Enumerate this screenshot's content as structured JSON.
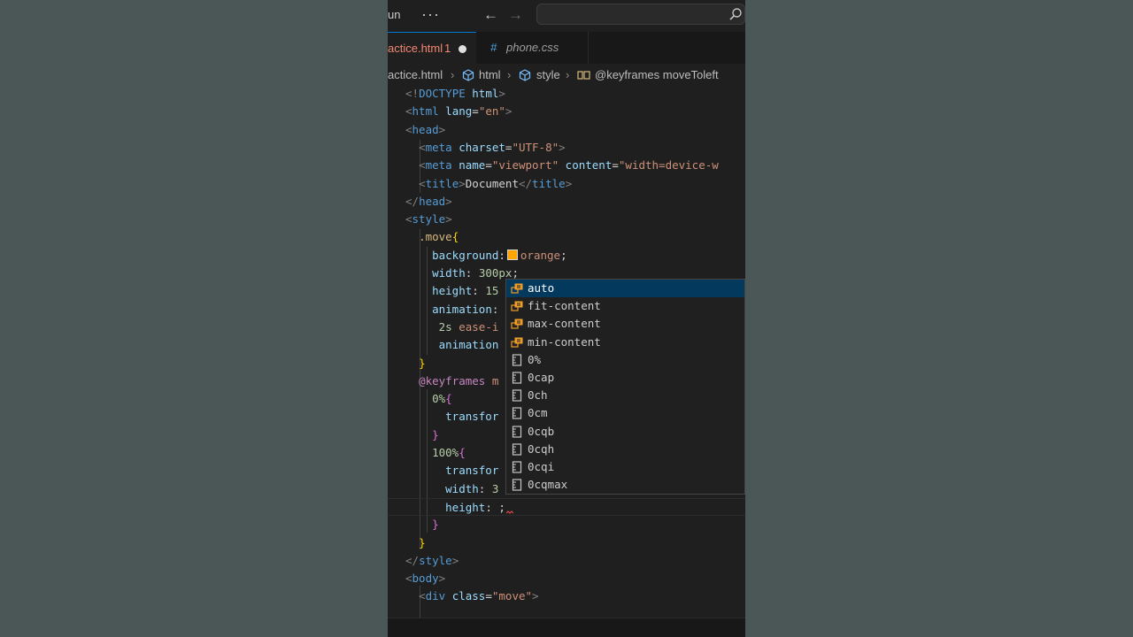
{
  "titlebar": {
    "title_fragment": "un",
    "more_label": "···",
    "back_icon": "arrow-left-icon",
    "forward_icon": "arrow-right-icon",
    "search_icon": "search-icon"
  },
  "tabs": [
    {
      "label": "actice.html",
      "problems": "1",
      "modified": true,
      "color": "#f48771"
    },
    {
      "hash": "#",
      "label": "phone.css",
      "color": "#9d9d9d"
    }
  ],
  "breadcrumb": {
    "file": "actice.html",
    "items": [
      {
        "label": "html",
        "icon": "cube-icon"
      },
      {
        "label": "style",
        "icon": "cube-icon"
      },
      {
        "label": "@keyframes moveToleft",
        "icon": "symbol-key-icon"
      }
    ]
  },
  "code_lines": [
    [
      [
        "t-tag",
        "<!"
      ],
      [
        "t-name",
        "DOCTYPE"
      ],
      [
        "t-text",
        " "
      ],
      [
        "t-attr",
        "html"
      ],
      [
        "t-tag",
        ">"
      ]
    ],
    [
      [
        "t-tag",
        "<"
      ],
      [
        "t-name",
        "html"
      ],
      [
        "t-text",
        " "
      ],
      [
        "t-attr",
        "lang"
      ],
      [
        "t-text",
        "="
      ],
      [
        "t-str",
        "\"en\""
      ],
      [
        "t-tag",
        ">"
      ]
    ],
    [
      [
        "t-tag",
        "<"
      ],
      [
        "t-name",
        "head"
      ],
      [
        "t-tag",
        ">"
      ]
    ],
    [
      [
        "t-text",
        "  "
      ],
      [
        "t-tag",
        "<"
      ],
      [
        "t-name",
        "meta"
      ],
      [
        "t-text",
        " "
      ],
      [
        "t-attr",
        "charset"
      ],
      [
        "t-text",
        "="
      ],
      [
        "t-str",
        "\"UTF-8\""
      ],
      [
        "t-tag",
        ">"
      ]
    ],
    [
      [
        "t-text",
        "  "
      ],
      [
        "t-tag",
        "<"
      ],
      [
        "t-name",
        "meta"
      ],
      [
        "t-text",
        " "
      ],
      [
        "t-attr",
        "name"
      ],
      [
        "t-text",
        "="
      ],
      [
        "t-str",
        "\"viewport\""
      ],
      [
        "t-text",
        " "
      ],
      [
        "t-attr",
        "content"
      ],
      [
        "t-text",
        "="
      ],
      [
        "t-str",
        "\"width=device-w"
      ]
    ],
    [
      [
        "t-text",
        "  "
      ],
      [
        "t-tag",
        "<"
      ],
      [
        "t-name",
        "title"
      ],
      [
        "t-tag",
        ">"
      ],
      [
        "t-text",
        "Document"
      ],
      [
        "t-tag",
        "</"
      ],
      [
        "t-name",
        "title"
      ],
      [
        "t-tag",
        ">"
      ]
    ],
    [
      [
        "t-tag",
        "</"
      ],
      [
        "t-name",
        "head"
      ],
      [
        "t-tag",
        ">"
      ]
    ],
    [
      [
        "t-tag",
        "<"
      ],
      [
        "t-name",
        "style"
      ],
      [
        "t-tag",
        ">"
      ]
    ],
    [
      [
        "t-text",
        "  "
      ],
      [
        "t-sel",
        ".move"
      ],
      [
        "t-br1",
        "{"
      ]
    ],
    [
      [
        "t-text",
        "    "
      ],
      [
        "t-prop",
        "background"
      ],
      [
        "t-text",
        ":"
      ],
      [
        "swatch",
        ""
      ],
      [
        "t-val",
        "orange"
      ],
      [
        "t-text",
        ";"
      ]
    ],
    [
      [
        "t-text",
        "    "
      ],
      [
        "t-prop",
        "width"
      ],
      [
        "t-text",
        ": "
      ],
      [
        "t-num",
        "300px"
      ],
      [
        "t-text",
        ";"
      ]
    ],
    [
      [
        "t-text",
        "    "
      ],
      [
        "t-prop",
        "height"
      ],
      [
        "t-text",
        ": "
      ],
      [
        "t-num",
        "15"
      ]
    ],
    [
      [
        "t-text",
        "    "
      ],
      [
        "t-prop",
        "animation"
      ],
      [
        "t-text",
        ":"
      ]
    ],
    [
      [
        "t-text",
        "     "
      ],
      [
        "t-num",
        "2s"
      ],
      [
        "t-text",
        " "
      ],
      [
        "t-val",
        "ease-i"
      ]
    ],
    [
      [
        "t-text",
        "     "
      ],
      [
        "t-prop",
        "animation"
      ]
    ],
    [
      [
        "t-text",
        "  "
      ],
      [
        "t-br1",
        "}"
      ]
    ],
    [
      [
        "t-text",
        "  "
      ],
      [
        "t-kw",
        "@keyframes"
      ],
      [
        "t-text",
        " "
      ],
      [
        "t-val",
        "m"
      ]
    ],
    [
      [
        "t-text",
        "    "
      ],
      [
        "t-num",
        "0%"
      ],
      [
        "t-br2",
        "{"
      ]
    ],
    [
      [
        "t-text",
        "      "
      ],
      [
        "t-prop",
        "transfor"
      ]
    ],
    [
      [
        "t-text",
        "    "
      ],
      [
        "t-br2",
        "}"
      ]
    ],
    [
      [
        "t-text",
        "    "
      ],
      [
        "t-num",
        "100%"
      ],
      [
        "t-br2",
        "{"
      ]
    ],
    [
      [
        "t-text",
        "      "
      ],
      [
        "t-prop",
        "transfor"
      ]
    ],
    [
      [
        "t-text",
        "      "
      ],
      [
        "t-prop",
        "width"
      ],
      [
        "t-text",
        ": "
      ],
      [
        "t-num",
        "3"
      ]
    ],
    [
      [
        "t-text",
        "      "
      ],
      [
        "t-prop",
        "height"
      ],
      [
        "t-text",
        ": ;"
      ]
    ],
    [
      [
        "t-text",
        "    "
      ],
      [
        "t-br2",
        "}"
      ]
    ],
    [
      [
        "t-text",
        "  "
      ],
      [
        "t-br1",
        "}"
      ]
    ],
    [
      [
        "t-tag",
        "</"
      ],
      [
        "t-name",
        "style"
      ],
      [
        "t-tag",
        ">"
      ]
    ],
    [
      [
        "t-tag",
        "<"
      ],
      [
        "t-name",
        "body"
      ],
      [
        "t-tag",
        ">"
      ]
    ],
    [
      [
        "t-text",
        "  "
      ],
      [
        "t-tag",
        "<"
      ],
      [
        "t-name",
        "div"
      ],
      [
        "t-text",
        " "
      ],
      [
        "t-attr",
        "class"
      ],
      [
        "t-text",
        "="
      ],
      [
        "t-str",
        "\"move\""
      ],
      [
        "t-tag",
        ">"
      ]
    ]
  ],
  "current_line": 23,
  "suggestions": [
    {
      "label": "auto",
      "icon": "enum-value-icon",
      "selected": true
    },
    {
      "label": "fit-content",
      "icon": "enum-value-icon"
    },
    {
      "label": "max-content",
      "icon": "enum-value-icon"
    },
    {
      "label": "min-content",
      "icon": "enum-value-icon"
    },
    {
      "label": "0%",
      "icon": "unit-icon"
    },
    {
      "label": "0cap",
      "icon": "unit-icon"
    },
    {
      "label": "0ch",
      "icon": "unit-icon"
    },
    {
      "label": "0cm",
      "icon": "unit-icon"
    },
    {
      "label": "0cqb",
      "icon": "unit-icon"
    },
    {
      "label": "0cqh",
      "icon": "unit-icon"
    },
    {
      "label": "0cqi",
      "icon": "unit-icon"
    },
    {
      "label": "0cqmax",
      "icon": "unit-icon"
    }
  ],
  "colors": {
    "accent": "#0078d4",
    "selection": "#04395e",
    "error": "#f48771",
    "swatch": "#ffa500"
  }
}
